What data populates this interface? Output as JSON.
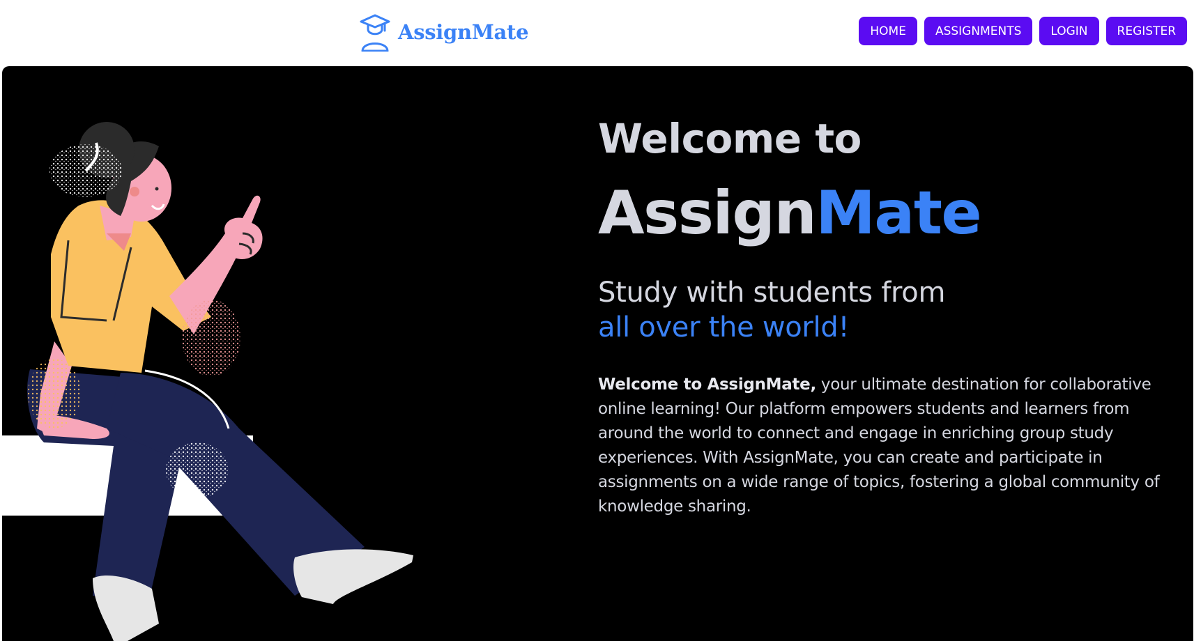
{
  "brand": {
    "name": "AssignMate",
    "logo_icon": "graduate-student-icon",
    "color": "#3b82f6"
  },
  "nav": {
    "items": [
      {
        "label": "HOME"
      },
      {
        "label": "ASSIGNMENTS"
      },
      {
        "label": "LOGIN"
      },
      {
        "label": "REGISTER"
      }
    ],
    "button_color": "#5b0cf2"
  },
  "hero": {
    "welcome": "Welcome to",
    "title_part1": "Assign",
    "title_part2": "Mate",
    "subtitle_line1": "Study with students from",
    "subtitle_line2": "all over the world!",
    "description_bold": "Welcome to AssignMate,",
    "description_rest": " your ultimate destination for collaborative online learning! Our platform empowers students and learners from around the world to connect and engage in enriching group study experiences. With AssignMate, you can create and participate in assignments on a wide range of topics, fostering a global community of knowledge sharing.",
    "illustration": "woman-sitting-pointing-illustration",
    "background": "#000000",
    "accent": "#3b82f6"
  }
}
